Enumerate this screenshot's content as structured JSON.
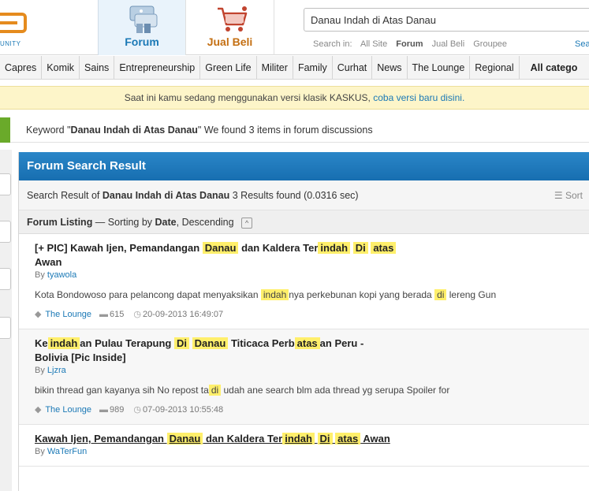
{
  "logo": {
    "text": "UNITY"
  },
  "tabs": [
    {
      "label": "Forum"
    },
    {
      "label": "Jual Beli"
    }
  ],
  "search": {
    "value": "Danau Indah di Atas Danau",
    "search_in_label": "Search in:",
    "options": [
      "All Site",
      "Forum",
      "Jual Beli",
      "Groupee"
    ],
    "selected": "Forum",
    "advanced_label": "Sea"
  },
  "nav": {
    "items": [
      "Capres",
      "Komik",
      "Sains",
      "Entrepreneurship",
      "Green Life",
      "Militer",
      "Family",
      "Curhat",
      "News",
      "The Lounge",
      "Regional"
    ],
    "all_label": "All catego"
  },
  "notice": {
    "text": "Saat ini kamu sedang menggunakan versi klasik KASKUS,",
    "link": "coba versi baru disini."
  },
  "keyword_bar": {
    "prefix": "Keyword \"",
    "keyword": "Danau Indah di Atas Danau",
    "suffix": "\" We found 3 items in forum discussions"
  },
  "panel": {
    "title": "Forum Search Result",
    "result_prefix": "Search Result of ",
    "result_keyword": "Danau Indah di Atas Danau",
    "result_suffix": " 3 Results found (0.0316 sec)",
    "sort_label": "Sort",
    "listing_label": "Forum Listing",
    "listing_sort": " — Sorting by ",
    "listing_sort_field": "Date",
    "listing_sort_dir": ", Descending"
  },
  "threads": [
    {
      "title_parts": [
        {
          "t": "[+ PIC] Kawah Ijen, Pemandangan ",
          "h": false
        },
        {
          "t": "Danau",
          "h": true
        },
        {
          "t": " dan Kaldera Ter",
          "h": false
        },
        {
          "t": "indah",
          "h": true
        },
        {
          "t": " ",
          "h": false
        },
        {
          "t": "Di",
          "h": true
        },
        {
          "t": " ",
          "h": false
        },
        {
          "t": "atas",
          "h": true
        },
        {
          "t": " Awan",
          "h": false
        }
      ],
      "author": "tyawola",
      "snippet_parts": [
        {
          "t": "Kota Bondowoso para pelancong dapat menyaksikan ",
          "h": false
        },
        {
          "t": "indah",
          "h": true
        },
        {
          "t": "nya perkebunan kopi yang berada ",
          "h": false
        },
        {
          "t": "di",
          "h": true
        },
        {
          "t": " lereng Gun",
          "h": false
        }
      ],
      "category": "The Lounge",
      "replies": "615",
      "date": "20-09-2013 16:49:07",
      "underlined": false
    },
    {
      "title_parts": [
        {
          "t": "Ke",
          "h": false
        },
        {
          "t": "indah",
          "h": true
        },
        {
          "t": "an Pulau Terapung ",
          "h": false
        },
        {
          "t": "Di",
          "h": true
        },
        {
          "t": " ",
          "h": false
        },
        {
          "t": "Danau",
          "h": true
        },
        {
          "t": " Titicaca Perb",
          "h": false
        },
        {
          "t": "atas",
          "h": true
        },
        {
          "t": "an Peru - Bolivia [Pic Inside]",
          "h": false
        }
      ],
      "author": "Ljzra",
      "snippet_parts": [
        {
          "t": "bikin thread gan kayanya sih No repost ta",
          "h": false
        },
        {
          "t": "di",
          "h": true
        },
        {
          "t": " udah ane search blm ada thread yg serupa Spoiler for",
          "h": false
        }
      ],
      "category": "The Lounge",
      "replies": "989",
      "date": "07-09-2013 10:55:48",
      "underlined": false
    },
    {
      "title_parts": [
        {
          "t": "Kawah Ijen, Pemandangan ",
          "h": false
        },
        {
          "t": "Danau",
          "h": true
        },
        {
          "t": " dan Kaldera Ter",
          "h": false
        },
        {
          "t": "indah",
          "h": true
        },
        {
          "t": " ",
          "h": false
        },
        {
          "t": "Di",
          "h": true
        },
        {
          "t": " ",
          "h": false
        },
        {
          "t": "atas",
          "h": true
        },
        {
          "t": " Awan",
          "h": false
        }
      ],
      "author": "WaTerFun",
      "snippet_parts": [],
      "category": "",
      "replies": "",
      "date": "",
      "underlined": true
    }
  ]
}
